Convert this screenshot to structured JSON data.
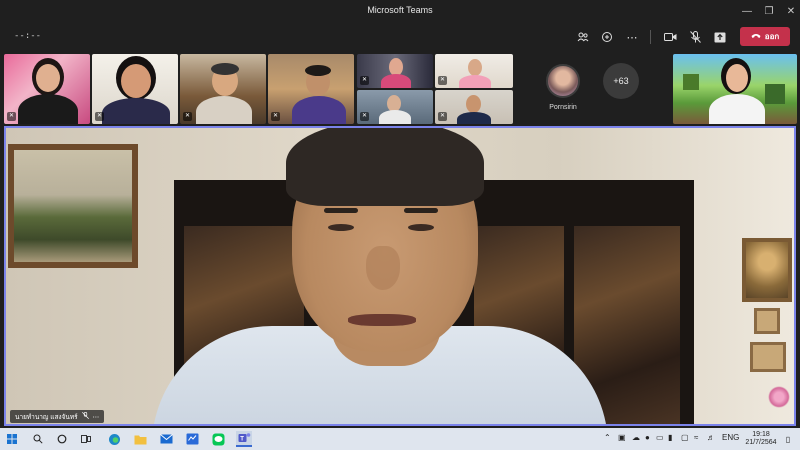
{
  "window": {
    "title": "Microsoft Teams",
    "minimize_icon": "minimize-icon",
    "restore_icon": "restore-icon",
    "close_icon": "close-icon"
  },
  "meeting": {
    "timer": "--:--",
    "leave_label": "ออก",
    "leave_color": "#c4314b",
    "controls": [
      "participants-icon",
      "share-tray-icon",
      "more-options-icon",
      "camera-icon",
      "mic-off-icon",
      "share-icon",
      "phone-hangup-icon"
    ]
  },
  "roster": {
    "highlighted_name": "Pornsirin",
    "overflow_count": "+63"
  },
  "stage": {
    "speaker_name": "นายทำนาญ แสงจันทร์",
    "border_color": "#7b83eb"
  },
  "taskbar": {
    "apps": [
      "windows-start-icon",
      "search-icon",
      "cortana-icon",
      "task-view-icon",
      "edge-icon",
      "file-explorer-icon",
      "mail-icon",
      "sticky-icon",
      "line-icon",
      "teams-icon"
    ],
    "language": "ENG",
    "time": "19:18",
    "date": "21/7/2564"
  }
}
